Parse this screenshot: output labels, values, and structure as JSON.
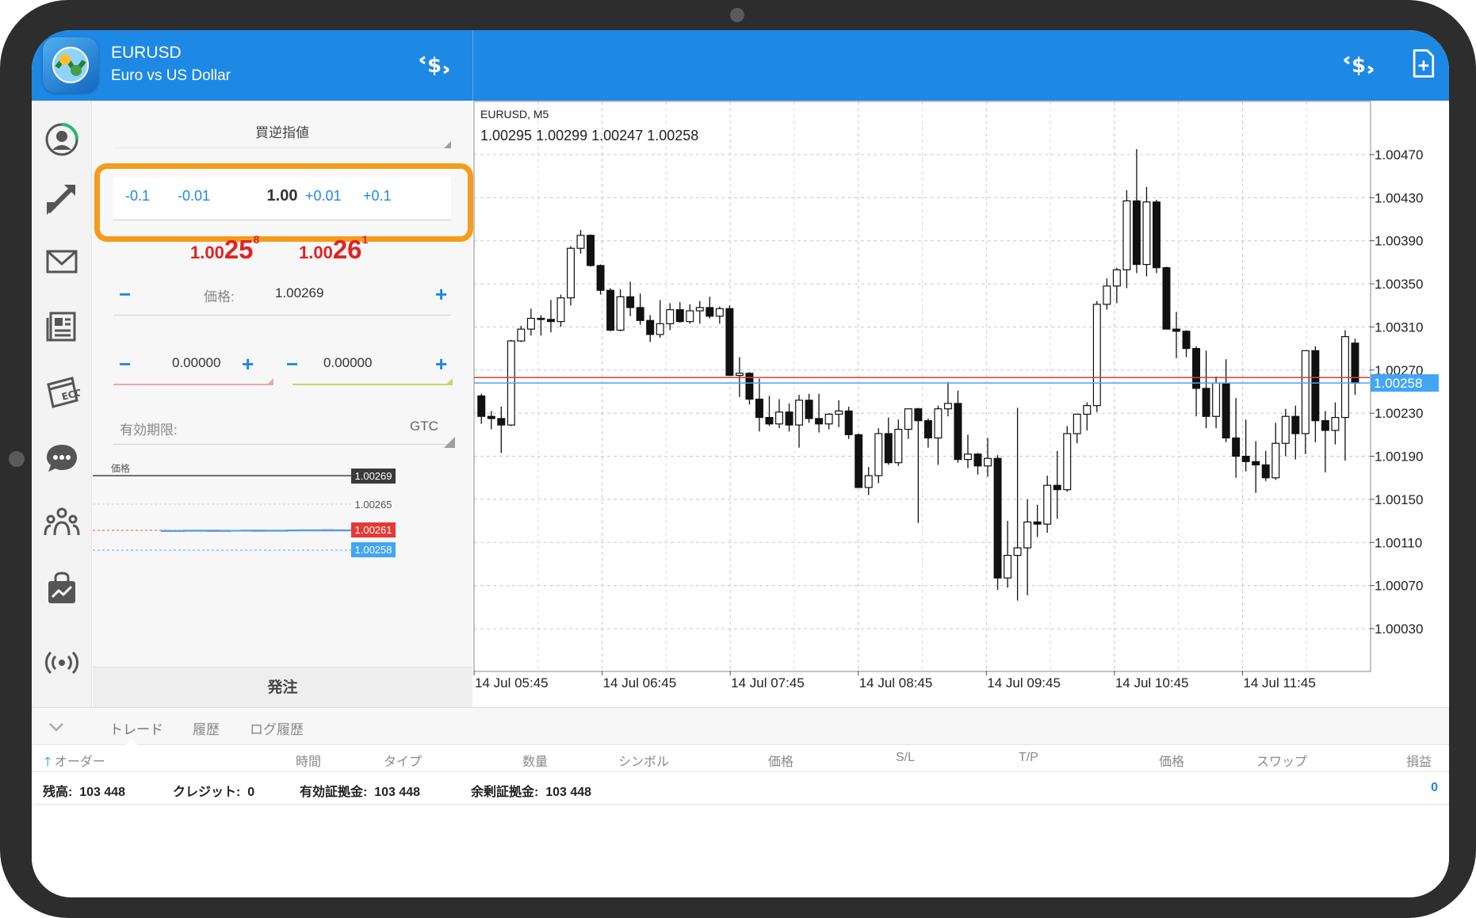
{
  "header": {
    "symbol": "EURUSD",
    "description": "Euro vs US Dollar"
  },
  "order": {
    "type": "買逆指値",
    "volume": {
      "steps": [
        "-0.1",
        "-0.01",
        "+0.01",
        "+0.1"
      ],
      "value": "1.00"
    },
    "bid": {
      "prefix": "1.00",
      "big": "25",
      "sup": "8"
    },
    "ask": {
      "prefix": "1.00",
      "big": "26",
      "sup": "1"
    },
    "price_label": "価格:",
    "price_value": "1.00269",
    "stop_loss": "0.00000",
    "take_profit": "0.00000",
    "expiry_label": "有効期限:",
    "expiry_value": "GTC",
    "minus": "−",
    "plus": "+",
    "place_button": "発注"
  },
  "mini_chart": {
    "price_label": "価格",
    "levels": [
      {
        "text": "1.00269",
        "color": "#3a3a3a"
      },
      {
        "text": "1.00265",
        "color": ""
      },
      {
        "text": "1.00261",
        "color": "#e53935"
      },
      {
        "text": "1.00258",
        "color": "#42a5f5"
      }
    ],
    "ask_line": [
      1.00252,
      1.00252,
      1.00256,
      1.00256,
      1.00256,
      1.00255,
      1.00255,
      1.00258,
      1.00258,
      1.00256,
      1.00256,
      1.00261,
      1.00262,
      1.00262,
      1.00264,
      1.00262,
      1.00261,
      1.00261
    ],
    "bid_line": [
      1.0025,
      1.0025,
      1.00253,
      1.00253,
      1.0025,
      1.0025,
      1.00255,
      1.00255,
      1.00252,
      1.00253,
      1.00253,
      1.00258,
      1.00259,
      1.00259,
      1.00258,
      1.00258,
      1.00258,
      1.00258
    ]
  },
  "chart_data": {
    "type": "candlestick",
    "title": "EURUSD, M5",
    "ohlc_label": "1.00295 1.00299 1.00247 1.00258",
    "y_ticks": [
      "1.00470",
      "1.00430",
      "1.00390",
      "1.00350",
      "1.00310",
      "1.00270",
      "1.00230",
      "1.00190",
      "1.00150",
      "1.00110",
      "1.00070",
      "1.00030"
    ],
    "ylim": [
      0.99991,
      1.0052
    ],
    "x_ticks": [
      "14 Jul 05:45",
      "14 Jul 06:45",
      "14 Jul 07:45",
      "14 Jul 08:45",
      "14 Jul 09:45",
      "14 Jul 10:45",
      "14 Jul 11:45"
    ],
    "current_price": "1.00258",
    "bid_value": 1.00258,
    "ask_value": 1.00263,
    "bid_color": "#42a5f5",
    "ask_color": "#e53935",
    "candles": [
      [
        1.00246,
        1.00248,
        1.0022,
        1.00227
      ],
      [
        1.00227,
        1.00232,
        1.00215,
        1.00225
      ],
      [
        1.00225,
        1.00236,
        1.00193,
        1.00219
      ],
      [
        1.00219,
        1.00298,
        1.00218,
        1.00297
      ],
      [
        1.00297,
        1.00311,
        1.00296,
        1.00308
      ],
      [
        1.00308,
        1.00327,
        1.00302,
        1.00318
      ],
      [
        1.00318,
        1.00321,
        1.00302,
        1.00317
      ],
      [
        1.00317,
        1.00335,
        1.00305,
        1.00315
      ],
      [
        1.00315,
        1.0034,
        1.0031,
        1.00337
      ],
      [
        1.00337,
        1.00385,
        1.0033,
        1.00383
      ],
      [
        1.00383,
        1.004,
        1.00378,
        1.00395
      ],
      [
        1.00395,
        1.00396,
        1.00366,
        1.00367
      ],
      [
        1.00367,
        1.00368,
        1.0034,
        1.00344
      ],
      [
        1.00344,
        1.00346,
        1.00306,
        1.00307
      ],
      [
        1.00307,
        1.00345,
        1.00306,
        1.00338
      ],
      [
        1.00338,
        1.00352,
        1.0032,
        1.00328
      ],
      [
        1.00328,
        1.00341,
        1.00312,
        1.00316
      ],
      [
        1.00316,
        1.00321,
        1.00296,
        1.00303
      ],
      [
        1.00303,
        1.00335,
        1.003,
        1.00313
      ],
      [
        1.00313,
        1.00332,
        1.00307,
        1.00326
      ],
      [
        1.00326,
        1.00333,
        1.00314,
        1.00315
      ],
      [
        1.00315,
        1.00331,
        1.00313,
        1.00325
      ],
      [
        1.00325,
        1.00334,
        1.00313,
        1.00328
      ],
      [
        1.00328,
        1.00338,
        1.00318,
        1.0032
      ],
      [
        1.0032,
        1.00329,
        1.00313,
        1.00327
      ],
      [
        1.00327,
        1.0033,
        1.00265,
        1.00265
      ],
      [
        1.00265,
        1.00282,
        1.00245,
        1.00267
      ],
      [
        1.00267,
        1.00268,
        1.00238,
        1.00243
      ],
      [
        1.00243,
        1.00262,
        1.00213,
        1.00226
      ],
      [
        1.00226,
        1.00246,
        1.00218,
        1.0022
      ],
      [
        1.0022,
        1.00243,
        1.00216,
        1.00231
      ],
      [
        1.00231,
        1.00239,
        1.00213,
        1.00219
      ],
      [
        1.00219,
        1.00247,
        1.00198,
        1.00242
      ],
      [
        1.00242,
        1.00248,
        1.00221,
        1.00225
      ],
      [
        1.00225,
        1.00248,
        1.00212,
        1.0022
      ],
      [
        1.0022,
        1.0023,
        1.00215,
        1.00229
      ],
      [
        1.00229,
        1.00242,
        1.00217,
        1.00232
      ],
      [
        1.00232,
        1.00236,
        1.00206,
        1.0021
      ],
      [
        1.0021,
        1.00211,
        1.00161,
        1.00161
      ],
      [
        1.00161,
        1.0018,
        1.00154,
        1.00172
      ],
      [
        1.00172,
        1.00216,
        1.00165,
        1.00211
      ],
      [
        1.00211,
        1.00226,
        1.00182,
        1.00184
      ],
      [
        1.00184,
        1.00224,
        1.00181,
        1.00215
      ],
      [
        1.00215,
        1.00234,
        1.00206,
        1.00234
      ],
      [
        1.00234,
        1.00235,
        1.00128,
        1.00223
      ],
      [
        1.00223,
        1.00225,
        1.00198,
        1.00207
      ],
      [
        1.00207,
        1.00237,
        1.00182,
        1.00234
      ],
      [
        1.00234,
        1.00259,
        1.00227,
        1.00239
      ],
      [
        1.00239,
        1.00251,
        1.00184,
        1.00187
      ],
      [
        1.00187,
        1.0021,
        1.00179,
        1.00192
      ],
      [
        1.00192,
        1.00193,
        1.00173,
        1.00181
      ],
      [
        1.00181,
        1.00207,
        1.00171,
        1.00188
      ],
      [
        1.00188,
        1.00191,
        1.00066,
        1.00077
      ],
      [
        1.00077,
        1.0013,
        1.00068,
        1.00098
      ],
      [
        1.00098,
        1.00235,
        1.00056,
        1.00105
      ],
      [
        1.00105,
        1.0015,
        1.00061,
        1.00129
      ],
      [
        1.00129,
        1.00145,
        1.00115,
        1.00127
      ],
      [
        1.00127,
        1.00172,
        1.00119,
        1.00163
      ],
      [
        1.00163,
        1.00195,
        1.00132,
        1.00159
      ],
      [
        1.00159,
        1.00218,
        1.00157,
        1.00211
      ],
      [
        1.00211,
        1.00217,
        1.00202,
        1.00229
      ],
      [
        1.00229,
        1.0024,
        1.00214,
        1.00237
      ],
      [
        1.00237,
        1.00334,
        1.00231,
        1.00331
      ],
      [
        1.00331,
        1.00355,
        1.00326,
        1.00348
      ],
      [
        1.00348,
        1.00365,
        1.00332,
        1.00363
      ],
      [
        1.00363,
        1.00437,
        1.00346,
        1.00427
      ],
      [
        1.00427,
        1.00475,
        1.0036,
        1.00368
      ],
      [
        1.00368,
        1.0044,
        1.00357,
        1.00426
      ],
      [
        1.00426,
        1.00428,
        1.0036,
        1.00365
      ],
      [
        1.00365,
        1.00366,
        1.00308,
        1.00308
      ],
      [
        1.00308,
        1.00324,
        1.00281,
        1.00306
      ],
      [
        1.00306,
        1.00307,
        1.00282,
        1.0029
      ],
      [
        1.0029,
        1.00292,
        1.00227,
        1.00253
      ],
      [
        1.00253,
        1.00288,
        1.00216,
        1.00227
      ],
      [
        1.00227,
        1.00264,
        1.00216,
        1.00258
      ],
      [
        1.00258,
        1.0028,
        1.00203,
        1.00207
      ],
      [
        1.00207,
        1.00244,
        1.0017,
        1.0019
      ],
      [
        1.0019,
        1.00224,
        1.00176,
        1.00185
      ],
      [
        1.00185,
        1.00204,
        1.00156,
        1.00182
      ],
      [
        1.00182,
        1.00195,
        1.00167,
        1.0017
      ],
      [
        1.0017,
        1.00221,
        1.00168,
        1.00202
      ],
      [
        1.00202,
        1.00234,
        1.0019,
        1.00227
      ],
      [
        1.00227,
        1.00237,
        1.00187,
        1.00211
      ],
      [
        1.00211,
        1.00278,
        1.00192,
        1.00288
      ],
      [
        1.00288,
        1.00292,
        1.00203,
        1.00223
      ],
      [
        1.00223,
        1.00232,
        1.00175,
        1.00214
      ],
      [
        1.00214,
        1.0024,
        1.00201,
        1.00226
      ],
      [
        1.00226,
        1.00307,
        1.00186,
        1.00301
      ],
      [
        1.00295,
        1.00299,
        1.00247,
        1.00258
      ]
    ]
  },
  "tabs": [
    "トレード",
    "履歴",
    "ログ履歴"
  ],
  "columns": [
    "オーダー",
    "時間",
    "タイプ",
    "数量",
    "シンボル",
    "価格",
    "S/L",
    "T/P",
    "価格",
    "スワップ",
    "損益"
  ],
  "summary": {
    "balance_label": "残高:",
    "balance": "103 448",
    "credit_label": "クレジット:",
    "credit": "0",
    "equity_label": "有効証拠金:",
    "equity": "103 448",
    "free_margin_label": "余剰証拠金:",
    "free_margin": "103 448",
    "profit": "0"
  },
  "colors": {
    "accent": "#1e88e5",
    "highlight": "#f59c1c",
    "bid_red": "#e02222"
  }
}
